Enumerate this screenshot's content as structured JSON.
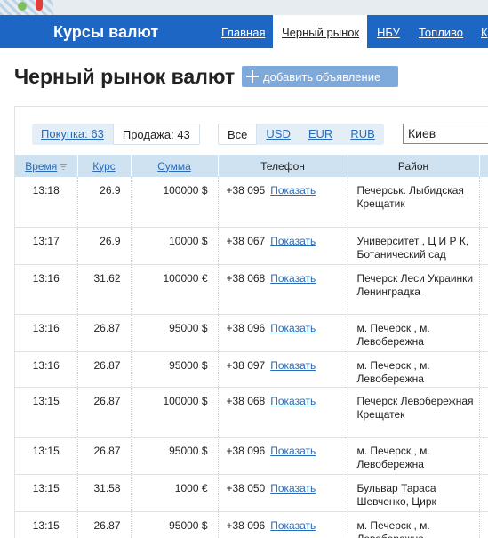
{
  "header": {
    "logo": "Курсы валют",
    "nav": [
      "Главная",
      "Черный рынок",
      "НБУ",
      "Топливо",
      "К"
    ],
    "active_nav": "Черный рынок"
  },
  "page": {
    "title": "Черный рынок валют",
    "add_button": "добавить объявление"
  },
  "filters": {
    "buy": "Покупка: 63",
    "sell": "Продажа: 43",
    "currencies": [
      "Все",
      "USD",
      "EUR",
      "RUB"
    ],
    "city": "Киев"
  },
  "table": {
    "columns": [
      "Время",
      "Курс",
      "Сумма",
      "Телефон",
      "Район"
    ],
    "show_label": "Показать",
    "rows": [
      {
        "time": "13:18",
        "rate": "26.9",
        "amount": "100000 $",
        "phone": "+38 095",
        "district": "Печерськ. Лыбидская Крещатик"
      },
      {
        "time": "13:17",
        "rate": "26.9",
        "amount": "10000 $",
        "phone": "+38 067",
        "district": "Университет , Ц И Р К, Ботанический сад"
      },
      {
        "time": "13:16",
        "rate": "31.62",
        "amount": "100000 €",
        "phone": "+38 068",
        "district": "Печерск Леси Украинки Ленинградка"
      },
      {
        "time": "13:16",
        "rate": "26.87",
        "amount": "95000 $",
        "phone": "+38 096",
        "district": "м. Печерск , м. Левобережна"
      },
      {
        "time": "13:16",
        "rate": "26.87",
        "amount": "95000 $",
        "phone": "+38 097",
        "district": "м. Печерск , м. Левобережна"
      },
      {
        "time": "13:15",
        "rate": "26.87",
        "amount": "100000 $",
        "phone": "+38 068",
        "district": "Печерск Левобережная Крещатек"
      },
      {
        "time": "13:15",
        "rate": "26.87",
        "amount": "95000 $",
        "phone": "+38 096",
        "district": "м. Печерск , м. Левобережна"
      },
      {
        "time": "13:15",
        "rate": "31.58",
        "amount": "1000 €",
        "phone": "+38 050",
        "district": "Бульвар Тараса Шевченко, Цирк"
      },
      {
        "time": "13:15",
        "rate": "26.87",
        "amount": "95000 $",
        "phone": "+38 096",
        "district": "м. Печерск , м. Левобережна"
      }
    ]
  }
}
